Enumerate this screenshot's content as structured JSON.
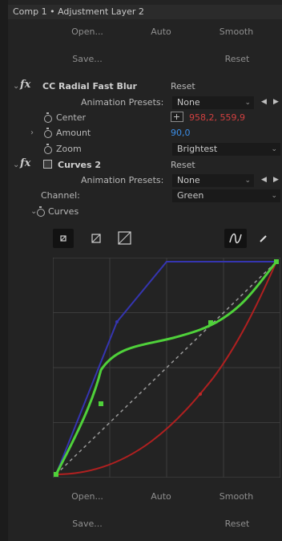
{
  "title": "Comp 1 • Adjustment Layer 2",
  "top_buttons": {
    "open": "Open...",
    "auto": "Auto",
    "smooth": "Smooth",
    "save": "Save...",
    "reset": "Reset"
  },
  "effects": {
    "radial_blur": {
      "name": "CC Radial Fast Blur",
      "reset": "Reset",
      "presets_label": "Animation Presets:",
      "presets_value": "None",
      "center_label": "Center",
      "center_value": "958,2, 559,9",
      "amount_label": "Amount",
      "amount_value": "90,0",
      "zoom_label": "Zoom",
      "zoom_value": "Brightest"
    },
    "curves": {
      "name": "Curves 2",
      "reset": "Reset",
      "presets_label": "Animation Presets:",
      "presets_value": "None",
      "channel_label": "Channel:",
      "channel_value": "Green",
      "curves_label": "Curves"
    }
  },
  "bottom_buttons": {
    "open": "Open...",
    "auto": "Auto",
    "smooth": "Smooth",
    "save": "Save...",
    "reset": "Reset"
  },
  "colors": {
    "accent_blue": "#3b8ee8",
    "value_red": "#d14040",
    "curve_green": "#4fd13a",
    "curve_blue": "#3b3bb8",
    "curve_red": "#b02020"
  },
  "icons": [
    "fx-icon",
    "stopwatch-icon",
    "crosshair-icon",
    "curves-effect-icon",
    "bezier-pen-icon",
    "pencil-icon"
  ]
}
